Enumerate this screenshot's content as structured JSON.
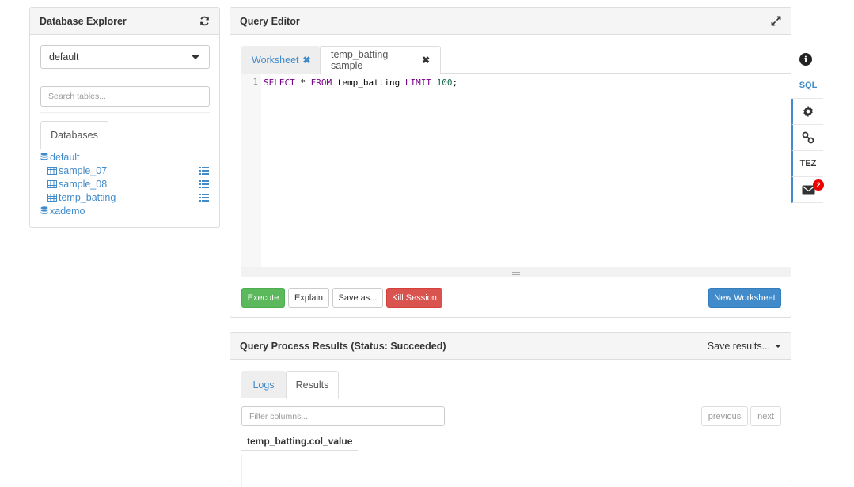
{
  "db_explorer": {
    "title": "Database Explorer",
    "selected_db": "default",
    "search_placeholder": "Search tables...",
    "tab_label": "Databases",
    "tree": {
      "db1": "default",
      "tables": [
        "sample_07",
        "sample_08",
        "temp_batting"
      ],
      "db2": "xademo"
    }
  },
  "query_editor": {
    "title": "Query Editor",
    "tabs": [
      "Worksheet",
      "temp_batting sample"
    ],
    "line_number": "1",
    "code": {
      "kw_select": "SELECT",
      "star": " * ",
      "kw_from": "FROM",
      "table": " temp_batting ",
      "kw_limit": "LIMIT",
      "space": " ",
      "number": "100",
      "end": ";"
    },
    "buttons": {
      "execute": "Execute",
      "explain": "Explain",
      "save_as": "Save as...",
      "kill_session": "Kill Session",
      "new_worksheet": "New Worksheet"
    }
  },
  "results": {
    "title": "Query Process Results (Status: Succeeded)",
    "save_results": "Save results...",
    "tabs": [
      "Logs",
      "Results"
    ],
    "filter_placeholder": "Filter columns...",
    "previous": "previous",
    "next": "next",
    "column": "temp_batting.col_value"
  },
  "side_nav": {
    "sql": "SQL",
    "tez": "TEZ",
    "badge": "2"
  },
  "colors": {
    "accent": "#428bca",
    "success": "#5cb85c",
    "danger": "#d9534f"
  }
}
